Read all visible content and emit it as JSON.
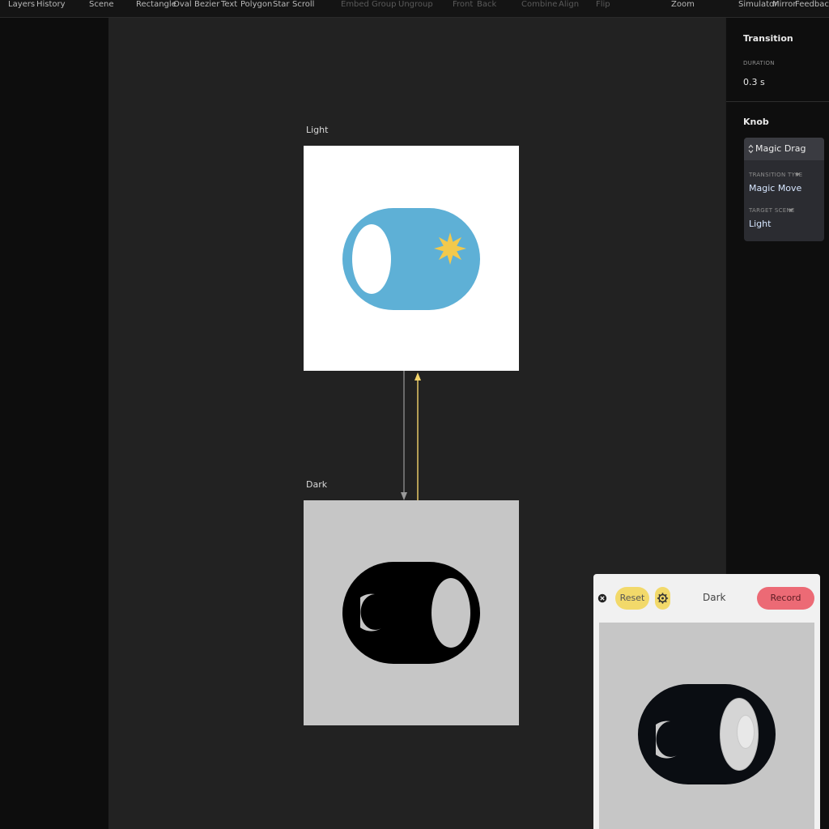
{
  "toolbar": {
    "layers": "Layers",
    "history": "History",
    "scene": "Scene",
    "rectangle": "Rectangle",
    "oval": "Oval",
    "bezier": "Bezier",
    "text": "Text",
    "polygon": "Polygon",
    "star": "Star",
    "scroll": "Scroll",
    "embed": "Embed",
    "group": "Group",
    "ungroup": "Ungroup",
    "front": "Front",
    "back": "Back",
    "combine": "Combine",
    "align": "Align",
    "flip": "Flip",
    "zoom": "Zoom",
    "simulator": "Simulator",
    "mirror": "Mirror",
    "feedback": "Feedback"
  },
  "canvas": {
    "scenes": [
      {
        "label": "Light",
        "toggle_color": "#5eb0d6",
        "icon": "sun-icon",
        "icon_color": "#f2c94c"
      },
      {
        "label": "Dark",
        "toggle_color": "#000000",
        "icon": "moon-icon",
        "icon_color": "#c6c6c6"
      }
    ],
    "connector_colors": {
      "down": "#9a9a9a",
      "up": "#f2d36b"
    }
  },
  "inspector": {
    "transition": {
      "title": "Transition",
      "duration_label": "DURATION",
      "duration_value": "0.3 s"
    },
    "knob": {
      "title": "Knob",
      "trigger": "Magic Drag",
      "trigger_icon": "updown-chevron-icon",
      "transition_type_label": "TRANSITION TYPE",
      "transition_type_value": "Magic Move",
      "target_scene_label": "TARGET SCENE",
      "target_scene_value": "Light"
    }
  },
  "preview": {
    "reset_label": "Reset",
    "scene_name": "Dark",
    "record_label": "Record",
    "colors": {
      "reset": "#f2d96a",
      "record": "#ec6a75"
    }
  }
}
